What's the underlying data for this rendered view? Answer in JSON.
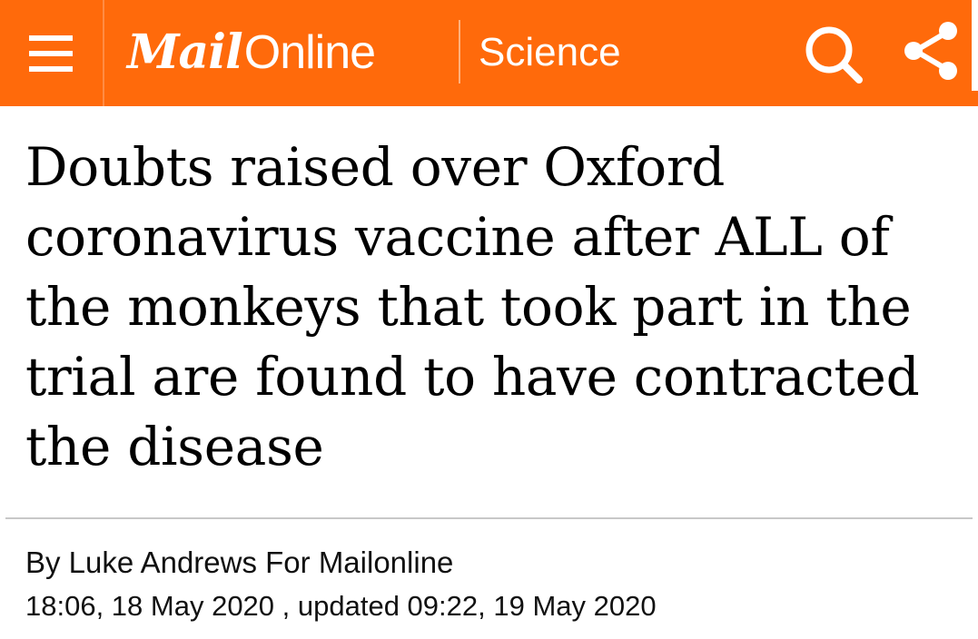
{
  "header": {
    "logo_mail": "Mail",
    "logo_online": "Online",
    "section": "Science",
    "background_color": "#ff6a0b",
    "icons": {
      "menu": "hamburger-menu-icon",
      "search": "search-icon",
      "share": "share-icon"
    }
  },
  "article": {
    "headline": "Doubts raised over Oxford coronavirus vaccine after ALL of the monkeys that took part in the trial are found to have contracted the disease",
    "byline": "By Luke Andrews For Mailonline",
    "dateline": "18:06, 18 May 2020 , updated 09:22, 19 May 2020"
  }
}
